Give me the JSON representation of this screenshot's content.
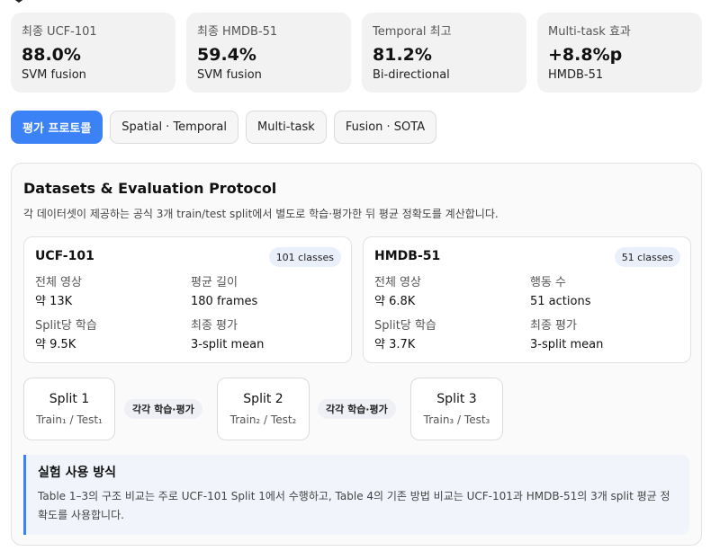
{
  "stats": [
    {
      "label": "최종 UCF-101",
      "value": "88.0%",
      "sub": "SVM fusion"
    },
    {
      "label": "최종 HMDB-51",
      "value": "59.4%",
      "sub": "SVM fusion"
    },
    {
      "label": "Temporal 최고",
      "value": "81.2%",
      "sub": "Bi-directional"
    },
    {
      "label": "Multi-task 효과",
      "value": "+8.8%p",
      "sub": "HMDB-51"
    }
  ],
  "tabs": [
    {
      "label": "평가 프로토콜",
      "active": true
    },
    {
      "label": "Spatial · Temporal",
      "active": false
    },
    {
      "label": "Multi-task",
      "active": false
    },
    {
      "label": "Fusion · SOTA",
      "active": false
    }
  ],
  "panel": {
    "title": "Datasets & Evaluation Protocol",
    "desc": "각 데이터셋이 제공하는 공식 3개 train/test split에서 별도로 학습·평가한 뒤 평균 정확도를 계산합니다."
  },
  "datasets": [
    {
      "name": "UCF-101",
      "badge": "101 classes",
      "cells": [
        {
          "label": "전체 영상",
          "value": "약 13K"
        },
        {
          "label": "평균 길이",
          "value": "180 frames"
        },
        {
          "label": "Split당 학습",
          "value": "약 9.5K"
        },
        {
          "label": "최종 평가",
          "value": "3-split mean"
        }
      ]
    },
    {
      "name": "HMDB-51",
      "badge": "51 classes",
      "cells": [
        {
          "label": "전체 영상",
          "value": "약 6.8K"
        },
        {
          "label": "행동 수",
          "value": "51 actions"
        },
        {
          "label": "Split당 학습",
          "value": "약 3.7K"
        },
        {
          "label": "최종 평가",
          "value": "3-split mean"
        }
      ]
    }
  ],
  "splits": [
    {
      "title": "Split 1",
      "sub": "Train₁ / Test₁"
    },
    {
      "title": "Split 2",
      "sub": "Train₂ / Test₂"
    },
    {
      "title": "Split 3",
      "sub": "Train₃ / Test₃"
    }
  ],
  "split_connectors": [
    "각각 학습·평가",
    "각각 학습·평가"
  ],
  "note": {
    "title": "실험 사용 방식",
    "body": "Table 1–3의 구조 비교는 주로 UCF-101 Split 1에서 수행하고, Table 4의 기존 방법 비교는 UCF-101과 HMDB-51의 3개 split 평균 정확도를 사용합니다."
  },
  "colors": {
    "accent": "#3b82f6",
    "card_bg": "#f2f2f3",
    "badge_bg": "#eaf0fb",
    "note_bg": "#f1f5fb"
  }
}
